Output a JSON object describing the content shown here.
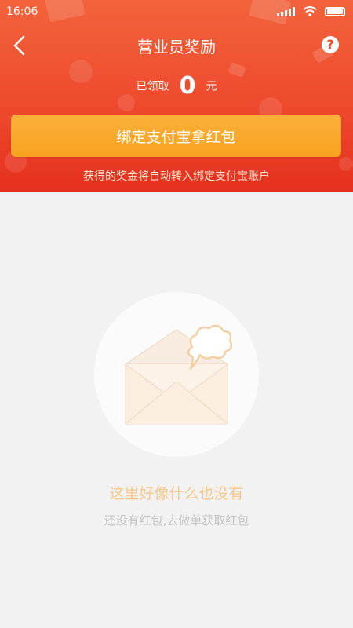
{
  "status_bar": {
    "time": "16:06",
    "icons": [
      "signal-icon",
      "wifi-icon",
      "battery-icon"
    ]
  },
  "nav": {
    "back_icon": "chevron-left-icon",
    "title": "营业员奖励",
    "help_icon": "question-circle-icon",
    "help_symbol": "?"
  },
  "summary": {
    "received_label": "已领取",
    "amount": "0",
    "unit": "元"
  },
  "bind_button": {
    "label": "绑定支付宝拿红包"
  },
  "notice": "获得的奖金将自动转入绑定支付宝账户",
  "empty_state": {
    "icon": "envelope-speech-bubble-icon",
    "title": "这里好像什么也没有",
    "subtitle": "还没有红包,去做单获取红包"
  },
  "colors": {
    "header_gradient_top": "#f2633b",
    "header_gradient_bottom": "#e5301d",
    "button": "#f7a21f",
    "empty_title": "#f8c98a",
    "empty_subtitle": "#c5c5c5",
    "background": "#f2f2f2"
  }
}
